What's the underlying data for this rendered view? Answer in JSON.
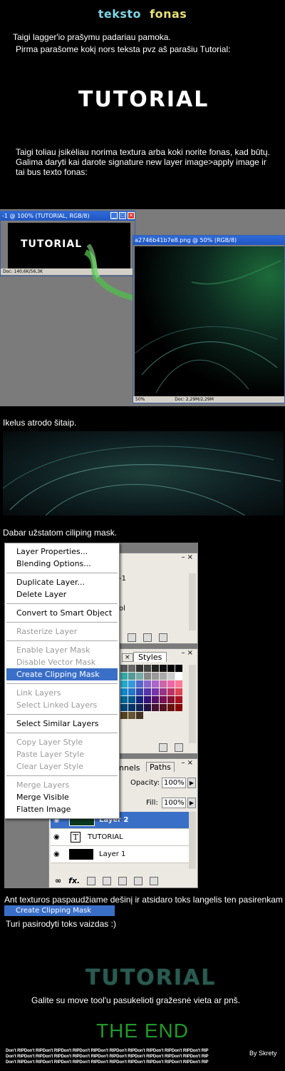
{
  "header": {
    "title_part1": "teksto",
    "title_part2": "fonas"
  },
  "intro": {
    "line1": "Taigi lagger'io prašymu padariau pamoka.",
    "line2": "Pirma parašome kokį nors teksta pvz aš parašiu Tutorial:"
  },
  "sample_text": "TUTORIAL",
  "step2": {
    "line1": "Taigi toliau įsikėliau norima textura arba koki norite fonas, kad būtų.",
    "line2": "Galima daryti kai darote signature new layer image>apply image ir",
    "line3": "tai bus texto fonas:"
  },
  "ps_window1": {
    "title": "-1 @ 100% (TUTORIAL, RGB/8)",
    "status": "Doc: 140,6K/56,3K",
    "canvas_text": "TUTORIAL"
  },
  "ps_window2": {
    "title": "a2746b41b7e8.png @ 50% (RGB/8)",
    "status_zoom": "50%",
    "status": "Doc: 2,29M/2,29M"
  },
  "step3": {
    "text": "Ikelus atrodo šitaip."
  },
  "step4": {
    "text": "Dabar užstatom ciliping mask."
  },
  "context_menu": {
    "items": [
      {
        "label": "Layer Properties...",
        "state": "normal"
      },
      {
        "label": "Blending Options...",
        "state": "normal"
      },
      {
        "label": "Duplicate Layer...",
        "state": "normal"
      },
      {
        "label": "Delete Layer",
        "state": "normal"
      },
      {
        "label": "Convert to Smart Object",
        "state": "normal"
      },
      {
        "label": "Rasterize Layer",
        "state": "disabled"
      },
      {
        "label": "Enable Layer Mask",
        "state": "disabled"
      },
      {
        "label": "Disable Vector Mask",
        "state": "disabled"
      },
      {
        "label": "Create Clipping Mask",
        "state": "selected"
      },
      {
        "label": "Link Layers",
        "state": "disabled"
      },
      {
        "label": "Select Linked Layers",
        "state": "disabled"
      },
      {
        "label": "Select Similar Layers",
        "state": "normal"
      },
      {
        "label": "Copy Layer Style",
        "state": "disabled"
      },
      {
        "label": "Paste Layer Style",
        "state": "disabled"
      },
      {
        "label": "Clear Layer Style",
        "state": "disabled"
      },
      {
        "label": "Merge Layers",
        "state": "disabled"
      },
      {
        "label": "Merge Visible",
        "state": "normal"
      },
      {
        "label": "Flatten Image",
        "state": "normal"
      }
    ]
  },
  "panels": {
    "top_fragment_1": "-1",
    "top_fragment_2": "ol",
    "styles_tab": "Styles",
    "tab_channels": "nnels",
    "tab_paths": "Paths",
    "opacity_label": "Opacity:",
    "opacity_value": "100%",
    "fill_label": "Fill:",
    "fill_value": "100%",
    "layers": [
      {
        "name": "Layer 2",
        "selected": true
      },
      {
        "name": "TUTORIAL",
        "selected": false
      },
      {
        "name": "Layer 1",
        "selected": false
      }
    ],
    "fx_label": "fx."
  },
  "step5": {
    "text": "Ant texturos paspaudžiame dešinį ir atsidaro toks langelis ten pasirenkam",
    "highlight": "Create Clipping Mask",
    "result": "Turi pasirodyti toks vaizdas :)"
  },
  "result_text": "TUTORIAL",
  "step6": {
    "text": "Galite su move tool'u pasukelioti gražesnė vieta ar pnš."
  },
  "the_end": "THE END",
  "footer": {
    "repeat_line": "Don't RIPDon't RIPDon't RIPDon't RIPDon't RIPDon't RIPDon't RIPDon't RIPDon't RIPDon't RIPDon't RIP",
    "author": "By Skrety"
  },
  "colors": {
    "background": "#000000",
    "highlight": "#3a6fc8",
    "the_end": "#1f9a2a",
    "title_part1": "#7ad6e6",
    "title_part2": "#e8e070"
  }
}
